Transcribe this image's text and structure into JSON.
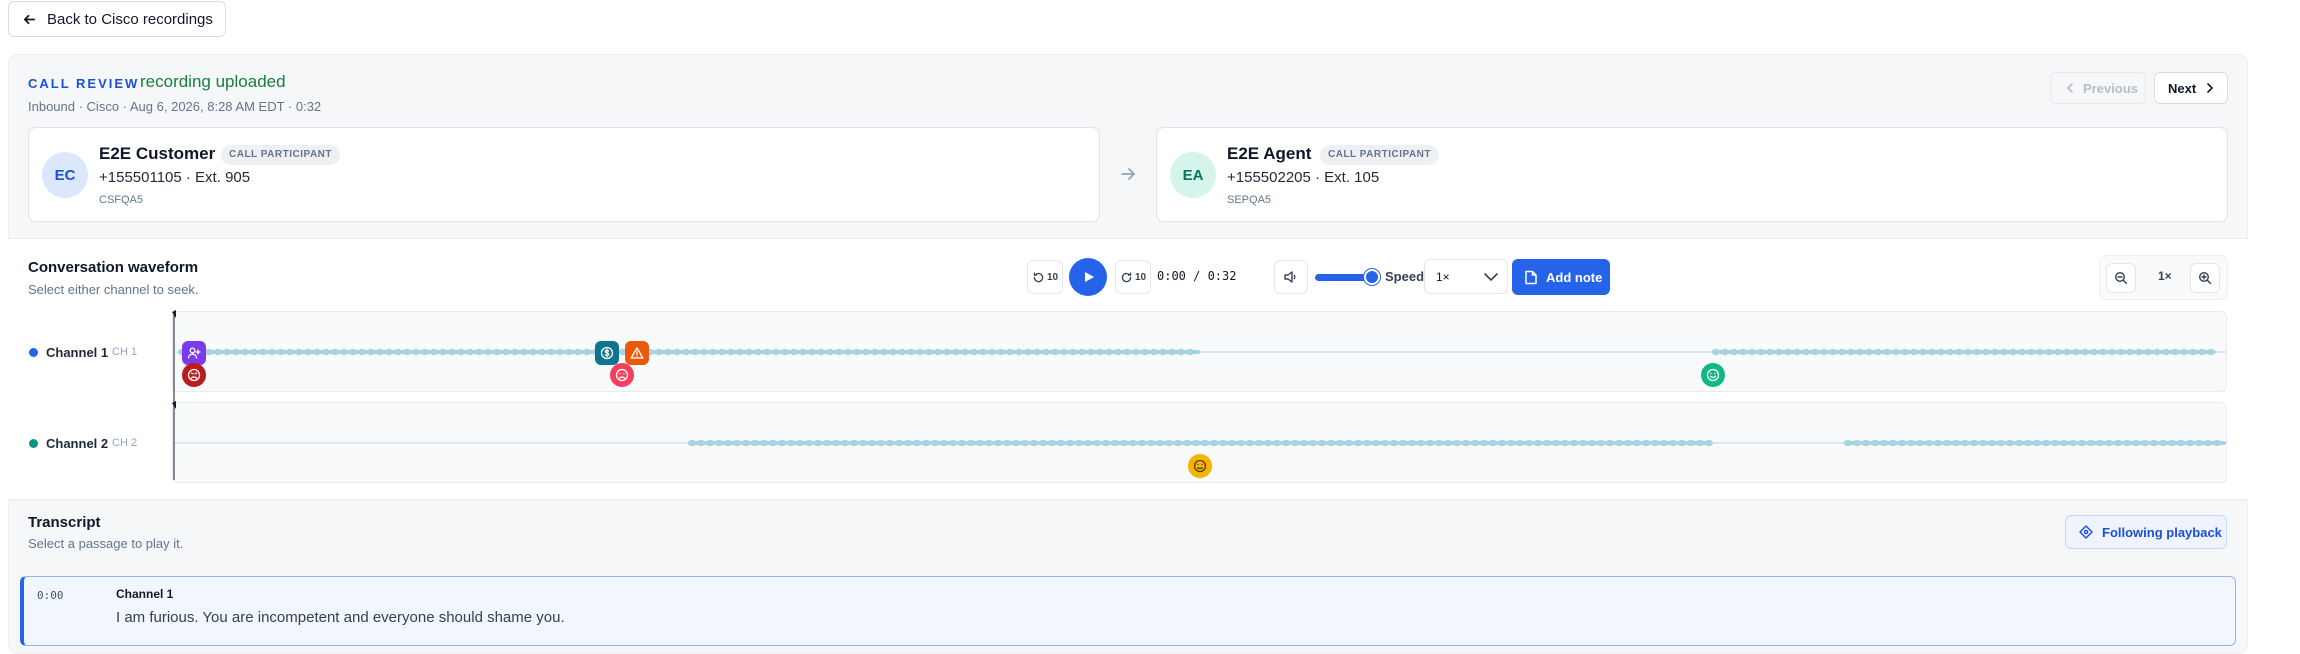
{
  "back_button": {
    "label": "Back to Cisco recordings",
    "icon": "arrow-left-icon"
  },
  "header": {
    "kicker": "CALL REVIEW",
    "status": "recording uploaded",
    "subtitle": "Inbound · Cisco · Aug 6, 2026, 8:28 AM EDT · 0:32",
    "previous_label": "Previous",
    "next_label": "Next"
  },
  "participants": [
    {
      "initials": "EC",
      "name": "E2E Customer",
      "badge": "CALL PARTICIPANT",
      "phone": "+155501105 · Ext. 905",
      "code": "CSFQA5",
      "avatar_bg": "#dbe7fb",
      "avatar_fg": "#1d4ed8"
    },
    {
      "initials": "EA",
      "name": "E2E Agent",
      "badge": "CALL PARTICIPANT",
      "phone": "+155502205 · Ext. 105",
      "code": "SEPQA5",
      "avatar_bg": "#d5f5ec",
      "avatar_fg": "#047857"
    }
  ],
  "waveform": {
    "title": "Conversation waveform",
    "subtitle": "Select either channel to seek.",
    "rewind_label": "10",
    "forward_label": "10",
    "time": "0:00 / 0:32",
    "volume": 1.0,
    "speed_label": "Speed",
    "speed_value": "1×",
    "add_note_label": "Add note",
    "zoom_level": "1×",
    "channels": [
      {
        "name": "Channel 1",
        "code": "CH 1",
        "color": "#2563eb"
      },
      {
        "name": "Channel 2",
        "code": "CH 2",
        "color": "#0d9488"
      }
    ]
  },
  "transcript": {
    "title": "Transcript",
    "subtitle": "Select a passage to play it.",
    "follow_label": "Following playback",
    "rows": [
      {
        "time": "0:00",
        "speaker": "Channel 1",
        "text": "I am furious. You are incompetent and everyone should shame you."
      }
    ]
  },
  "colors": {
    "accent": "#2563eb",
    "status_green": "#15803d",
    "wave": "#a8d3e3"
  }
}
